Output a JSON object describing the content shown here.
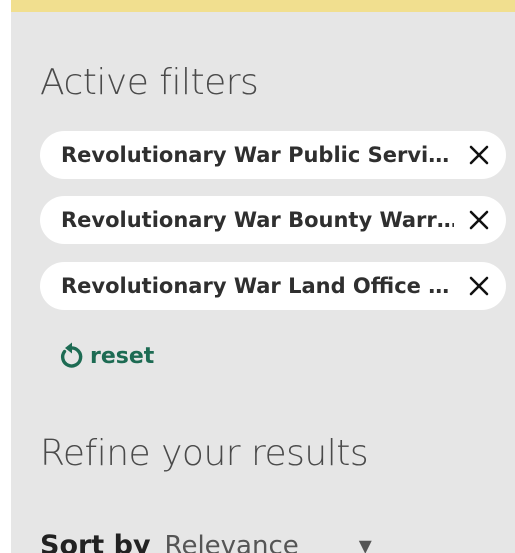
{
  "colors": {
    "panel_background": "#e6e6e6",
    "top_accent": "#f1df8f",
    "chip_background": "#ffffff",
    "reset_link": "#1d6b53"
  },
  "active_filters": {
    "heading": "Active filters",
    "chips": [
      {
        "label": "Revolutionary War Public Servi…",
        "remove_icon": "close-icon"
      },
      {
        "label": "Revolutionary War Bounty Warr…",
        "remove_icon": "close-icon"
      },
      {
        "label": "Revolutionary War Land Office …",
        "remove_icon": "close-icon"
      }
    ],
    "reset": {
      "label": "reset",
      "icon": "undo-arrow-icon"
    }
  },
  "refine": {
    "heading": "Refine your results",
    "sort": {
      "label": "Sort by",
      "value": "Relevance"
    }
  }
}
